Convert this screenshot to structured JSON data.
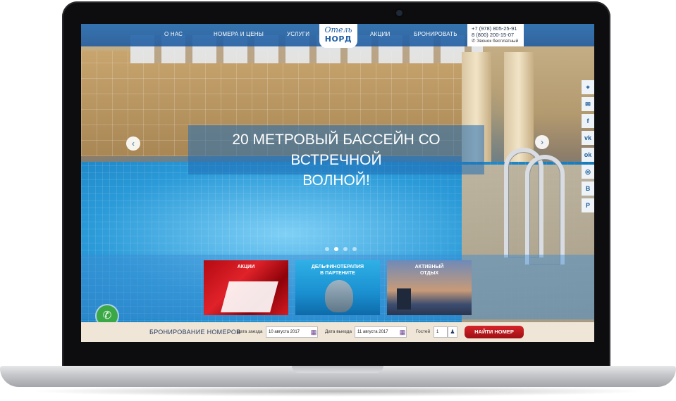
{
  "nav": {
    "items": [
      {
        "label": "О НАС"
      },
      {
        "label": "НОМЕРА И ЦЕНЫ"
      },
      {
        "label": "УСЛУГИ"
      },
      {
        "label": "АКЦИИ"
      },
      {
        "label": "БРОНИРОВАТЬ"
      }
    ],
    "logo": {
      "script": "Отель",
      "word": "НОРД"
    },
    "phones": {
      "line1": "+7 (978) 805-25-91",
      "line2": "8 (800) 200-15-07",
      "callfree": "Звонок бесплатный"
    }
  },
  "hero": {
    "title_line1": "20 МЕТРОВЫЙ БАССЕЙН СО ВСТРЕЧНОЙ",
    "title_line2": "ВОЛНОЙ!",
    "prev_icon": "chevron-left-icon",
    "next_icon": "chevron-right-icon"
  },
  "social": [
    "map-pin-icon",
    "mail-icon",
    "facebook-icon",
    "vk-icon",
    "odnoklassniki-icon",
    "tripadvisor-icon",
    "booking-icon",
    "pin-icon"
  ],
  "promos": [
    {
      "label_line1": "АКЦИИ",
      "label_line2": ""
    },
    {
      "label_line1": "ДЕЛЬФИНОТЕРАПИЯ",
      "label_line2": "В ПАРТЕНИТЕ"
    },
    {
      "label_line1": "АКТИВНЫЙ",
      "label_line2": "ОТДЫХ"
    }
  ],
  "booking": {
    "title": "БРОНИРОВАНИЕ НОМЕРОВ",
    "checkin_label": "Дата заезда",
    "checkin_value": "10 августа 2017",
    "checkout_label": "Дата выезда",
    "checkout_value": "11 августа 2017",
    "guests_label": "Гостей",
    "guests_value": "1",
    "button": "НАЙТИ НОМЕР"
  },
  "colors": {
    "brand": "#1f5fa8",
    "accent": "#c8161d",
    "call": "#3aa845"
  }
}
